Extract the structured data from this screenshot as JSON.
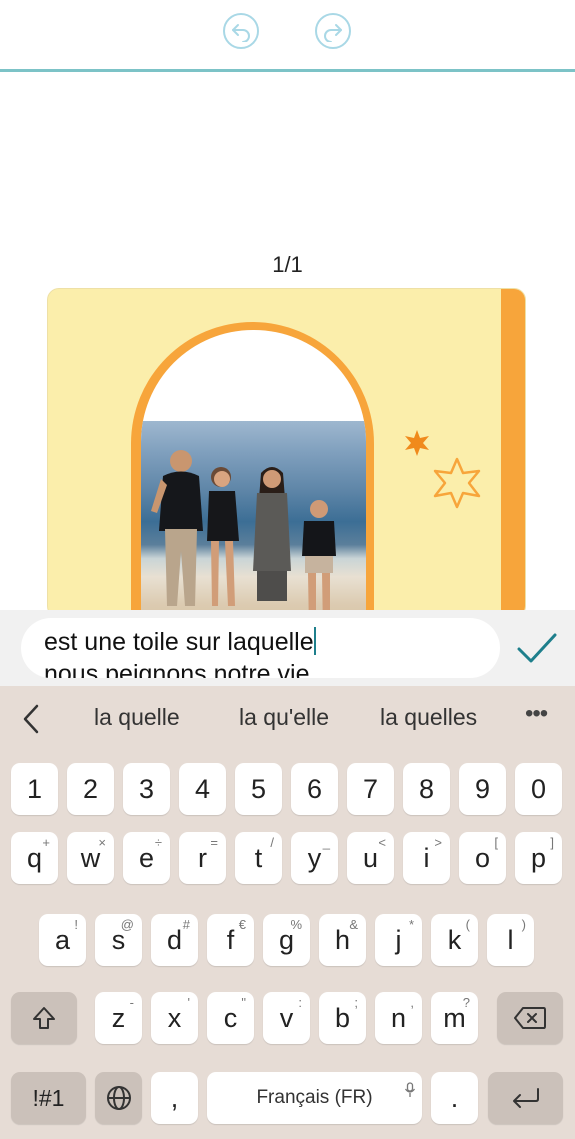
{
  "toolbar": {
    "undo_icon": "undo-icon",
    "redo_icon": "redo-icon"
  },
  "page_indicator": "1/1",
  "design": {
    "colors": {
      "background": "#fbeeab",
      "accent": "#f7a53b",
      "divider": "#7cc3c7"
    }
  },
  "editor": {
    "lines": [
      "est une toile sur laquelle",
      "nous peignons notre vie"
    ],
    "confirm_icon": "checkmark-icon"
  },
  "keyboard": {
    "suggestions": [
      "la quelle",
      "la qu'elle",
      "la quelles"
    ],
    "more": "•••",
    "number_row": [
      "1",
      "2",
      "3",
      "4",
      "5",
      "6",
      "7",
      "8",
      "9",
      "0"
    ],
    "row1": [
      {
        "k": "q",
        "s": "+"
      },
      {
        "k": "w",
        "s": "×"
      },
      {
        "k": "e",
        "s": "÷"
      },
      {
        "k": "r",
        "s": "="
      },
      {
        "k": "t",
        "s": "/"
      },
      {
        "k": "y",
        "s": "_"
      },
      {
        "k": "u",
        "s": "<"
      },
      {
        "k": "i",
        "s": ">"
      },
      {
        "k": "o",
        "s": "["
      },
      {
        "k": "p",
        "s": "]"
      }
    ],
    "row2": [
      {
        "k": "a",
        "s": "!"
      },
      {
        "k": "s",
        "s": "@"
      },
      {
        "k": "d",
        "s": "#"
      },
      {
        "k": "f",
        "s": "€"
      },
      {
        "k": "g",
        "s": "%"
      },
      {
        "k": "h",
        "s": "&"
      },
      {
        "k": "j",
        "s": "*"
      },
      {
        "k": "k",
        "s": "("
      },
      {
        "k": "l",
        "s": ")"
      }
    ],
    "row3": [
      {
        "k": "z",
        "s": "-"
      },
      {
        "k": "x",
        "s": "'"
      },
      {
        "k": "c",
        "s": "\""
      },
      {
        "k": "v",
        "s": ":"
      },
      {
        "k": "b",
        "s": ";"
      },
      {
        "k": "n",
        "s": ","
      },
      {
        "k": "m",
        "s": "?"
      }
    ],
    "symbols_label": "!#1",
    "comma": ",",
    "space_label": "Français (FR)",
    "period": "."
  }
}
